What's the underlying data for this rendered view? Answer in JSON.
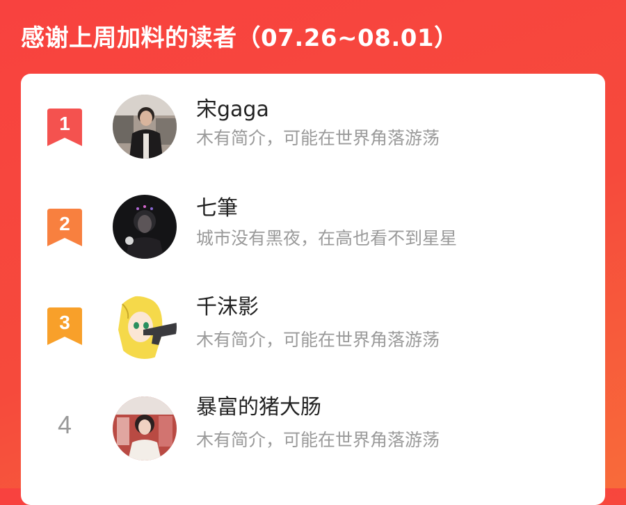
{
  "header": {
    "title": "感谢上周加料的读者（07.26~08.01）"
  },
  "colors": {
    "background": "#f8423f",
    "card": "#ffffff",
    "rank1": "#f4524f",
    "rank2": "#f8803f",
    "rank3": "#f8a02a",
    "rank_plain": "#999999"
  },
  "readers": [
    {
      "rank": "1",
      "name": "宋gaga",
      "bio": "木有简介，可能在世界角落游荡",
      "badge_color": "#f4524f",
      "avatar_icon": "photo-avatar-person"
    },
    {
      "rank": "2",
      "name": "七筆",
      "bio": "城市没有黑夜，在高也看不到星星",
      "badge_color": "#f8803f",
      "avatar_icon": "dark-portrait-avatar"
    },
    {
      "rank": "3",
      "name": "千沫影",
      "bio": "木有简介，可能在世界角落游荡",
      "badge_color": "#f8a02a",
      "avatar_icon": "anime-girl-avatar"
    },
    {
      "rank": "4",
      "name": "暴富的猪大肠",
      "bio": "木有简介，可能在世界角落游荡",
      "badge_color": "",
      "avatar_icon": "photo-avatar-girl"
    }
  ]
}
